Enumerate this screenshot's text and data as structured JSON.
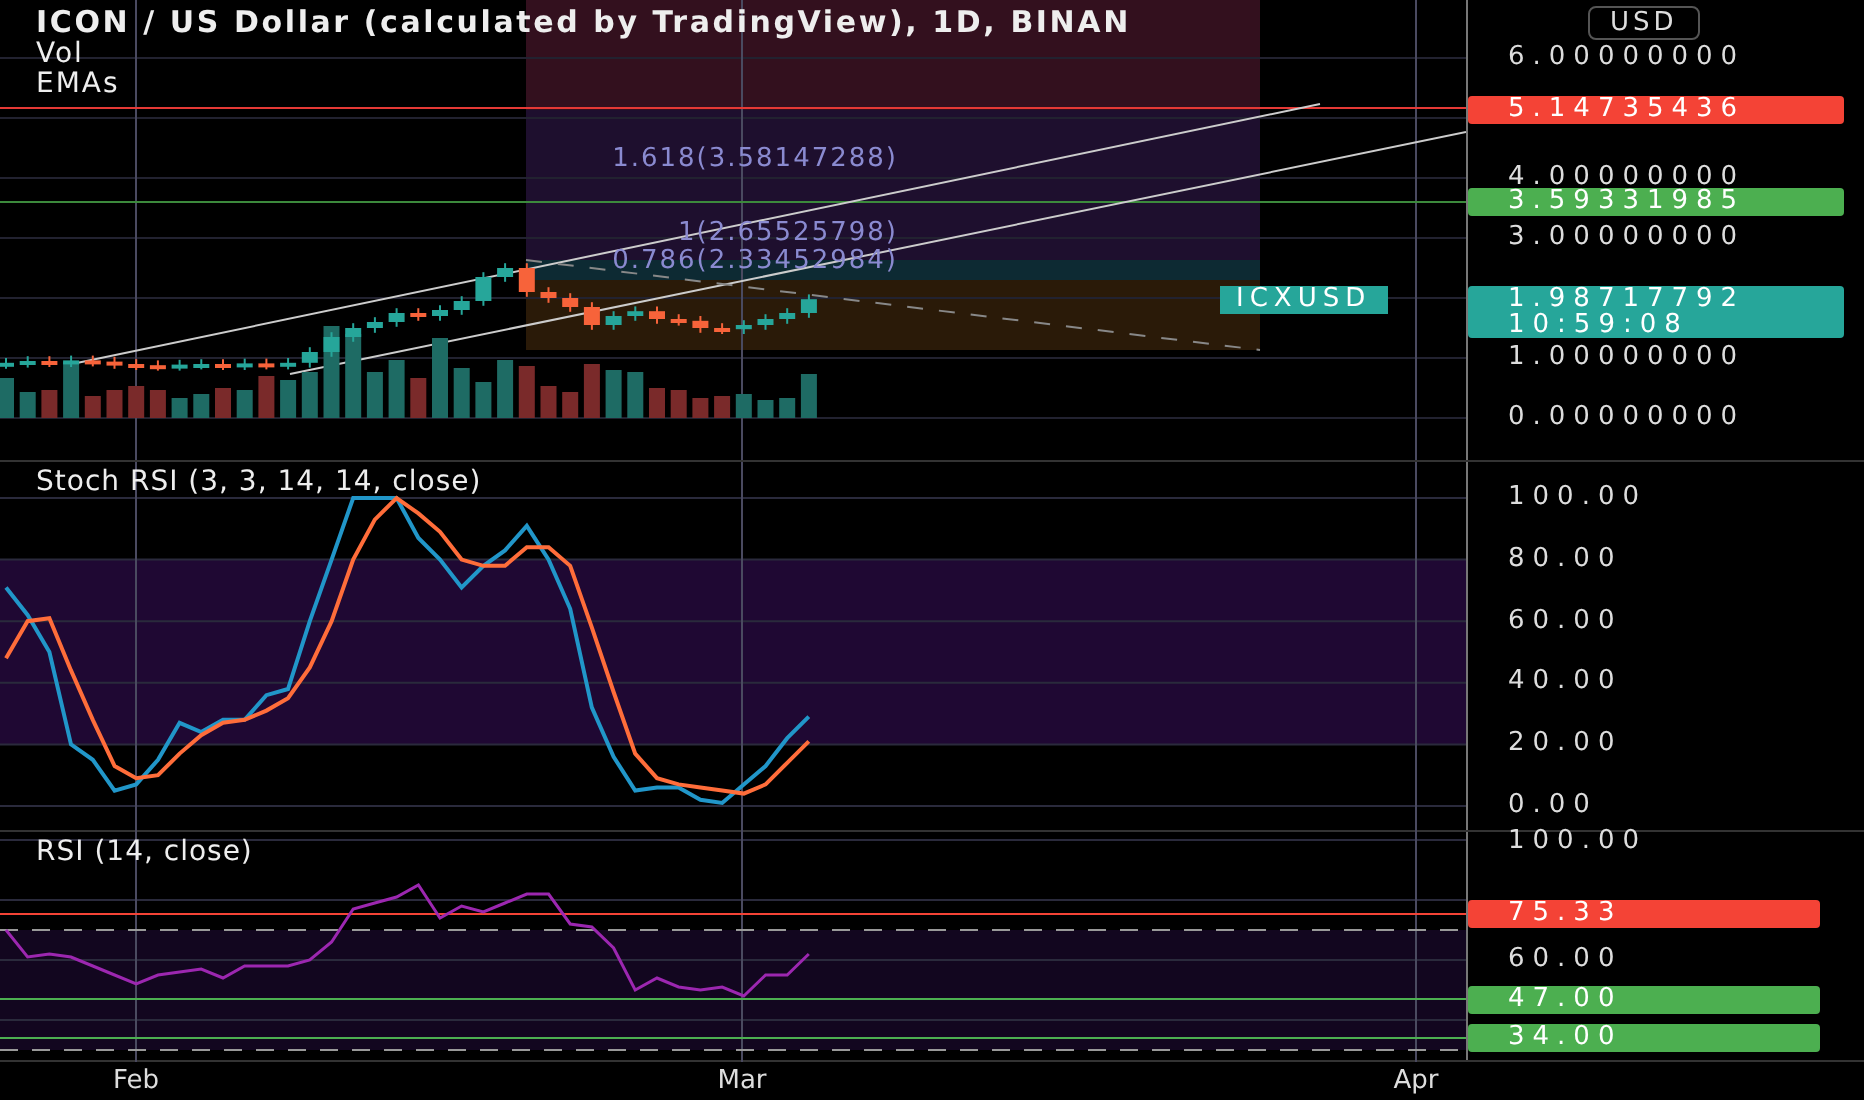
{
  "legend": {
    "title": "ICON / US Dollar (calculated by TradingView), 1D, BINAN",
    "lines": [
      "Vol",
      "EMAs"
    ]
  },
  "currency_button": {
    "label": "USD"
  },
  "price_chart": {
    "fib_labels": [
      "1.618(3.58147288)",
      "1(2.65525798)",
      "0.786(2.33452984)"
    ],
    "price_ticks": [
      "6.00000000",
      "4.00000000",
      "3.00000000",
      "1.00000000",
      "0.00000000"
    ],
    "price_labels": [
      {
        "text": "5.14735436",
        "color": "#f44336"
      },
      {
        "text": "3.59331985",
        "color": "#4caf50"
      }
    ],
    "symbol_tag": "ICXUSD",
    "last_price": "1.98717792",
    "countdown": "10:59:08"
  },
  "stoch_rsi": {
    "chart_data": {
      "type": "line",
      "title": "Stoch RSI (3, 3, 14, 14, close)",
      "ylim": [
        0,
        100
      ],
      "grid": true,
      "yticks": [
        {
          "value": 0,
          "label": "0.00"
        },
        {
          "value": 20,
          "label": "20.00"
        },
        {
          "value": 40,
          "label": "40.00"
        },
        {
          "value": 60,
          "label": "60.00"
        },
        {
          "value": 80,
          "label": "80.00"
        },
        {
          "value": 100,
          "label": "100.00"
        }
      ],
      "series": [
        {
          "color": "#2196c9",
          "values": [
            71,
            62,
            50,
            20,
            15,
            5,
            7,
            15,
            27,
            24,
            28,
            28,
            36,
            38,
            60,
            80,
            100,
            100,
            100,
            87,
            80,
            71,
            78,
            83,
            91,
            80,
            64,
            32,
            16,
            5,
            6,
            6,
            2,
            1,
            7,
            13,
            22,
            29
          ]
        },
        {
          "color": "#ff6d3a",
          "values": [
            48,
            60,
            61,
            44,
            28,
            13,
            9,
            10,
            17,
            23,
            27,
            28,
            31,
            35,
            45,
            60,
            80,
            93,
            100,
            95,
            89,
            80,
            78,
            78,
            84,
            84,
            78,
            58,
            37,
            17,
            9,
            7,
            6,
            5,
            4,
            7,
            14,
            21
          ]
        }
      ]
    }
  },
  "rsi": {
    "chart_data": {
      "type": "line",
      "title": "RSI (14, close)",
      "ylim": [
        26,
        100
      ],
      "grid": true,
      "yticks": [
        {
          "value": 60,
          "label": "60.00"
        },
        {
          "value": 100,
          "label": "100.00"
        }
      ],
      "ref_lines": [
        {
          "axis": "y",
          "value": 75.33,
          "label": "75.33",
          "color": "#f44336"
        },
        {
          "axis": "y",
          "value": 70,
          "color": "#999999"
        },
        {
          "axis": "y",
          "value": 47,
          "label": "47.00",
          "color": "#4caf50"
        },
        {
          "axis": "y",
          "value": 34,
          "label": "34.00",
          "color": "#4caf50"
        },
        {
          "axis": "y",
          "value": 30,
          "color": "#999999"
        }
      ],
      "series": [
        {
          "color": "#9c27b0",
          "values": [
            70,
            61,
            62,
            61,
            58,
            55,
            52,
            55,
            56,
            57,
            54,
            58,
            58,
            58,
            60,
            66,
            77,
            79,
            81,
            85,
            74,
            78,
            76,
            79,
            82,
            82,
            72,
            71,
            64,
            50,
            54,
            51,
            50,
            51,
            48,
            55,
            55,
            62
          ]
        }
      ]
    }
  },
  "time_axis": {
    "labels": [
      "Feb",
      "Mar",
      "Apr"
    ]
  }
}
